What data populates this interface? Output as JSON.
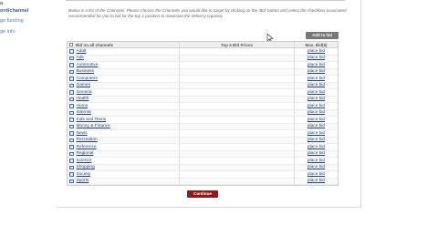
{
  "sidebar": {
    "links": [
      {
        "label": "o",
        "style": "dark"
      },
      {
        "label": "ord/channel",
        "style": "dark"
      },
      {
        "label": "ge funding",
        "style": "blue"
      },
      {
        "label": "ge info",
        "style": "blue"
      }
    ]
  },
  "header": {
    "top_text": "",
    "intro_lines": [
      "Below is a list of the Channels. Please choose the Channels you would like to target by clicking on the 'Bid' button and select the checkbox associated",
      "recommended for you to bid for the top 1 position to maximize the delivery capacity."
    ]
  },
  "toolbar": {
    "add_label": "Add to list"
  },
  "table": {
    "headers": {
      "channel": "Bid on all channels",
      "top_bids": "Top 5 Bid Prices",
      "max_bid": "Max. Bid($)"
    },
    "rows": [
      {
        "channel": "Adult",
        "action": "place bid"
      },
      {
        "channel": "Ads",
        "action": "place bid"
      },
      {
        "channel": "Automotive",
        "action": "place bid"
      },
      {
        "channel": "Business",
        "action": "place bid"
      },
      {
        "channel": "Computers",
        "action": "place bid"
      },
      {
        "channel": "Games",
        "action": "place bid"
      },
      {
        "channel": "General",
        "action": "place bid"
      },
      {
        "channel": "Health",
        "action": "place bid"
      },
      {
        "channel": "Home",
        "action": "place bid"
      },
      {
        "channel": "Internet",
        "action": "place bid"
      },
      {
        "channel": "Kids and Teens",
        "action": "place bid"
      },
      {
        "channel": "Money & Finance",
        "action": "place bid"
      },
      {
        "channel": "News",
        "action": "place bid"
      },
      {
        "channel": "Recreation",
        "action": "place bid"
      },
      {
        "channel": "Reference",
        "action": "place bid"
      },
      {
        "channel": "Regional",
        "action": "place bid"
      },
      {
        "channel": "Science",
        "action": "place bid"
      },
      {
        "channel": "Shopping",
        "action": "place bid"
      },
      {
        "channel": "Society",
        "action": "place bid"
      },
      {
        "channel": "Sports",
        "action": "place bid"
      }
    ]
  },
  "footer": {
    "continue_label": "Continue"
  },
  "colors": {
    "link": "#1f3f7a",
    "continue_bg": "#8b1c1c",
    "add_bg": "#777777"
  }
}
